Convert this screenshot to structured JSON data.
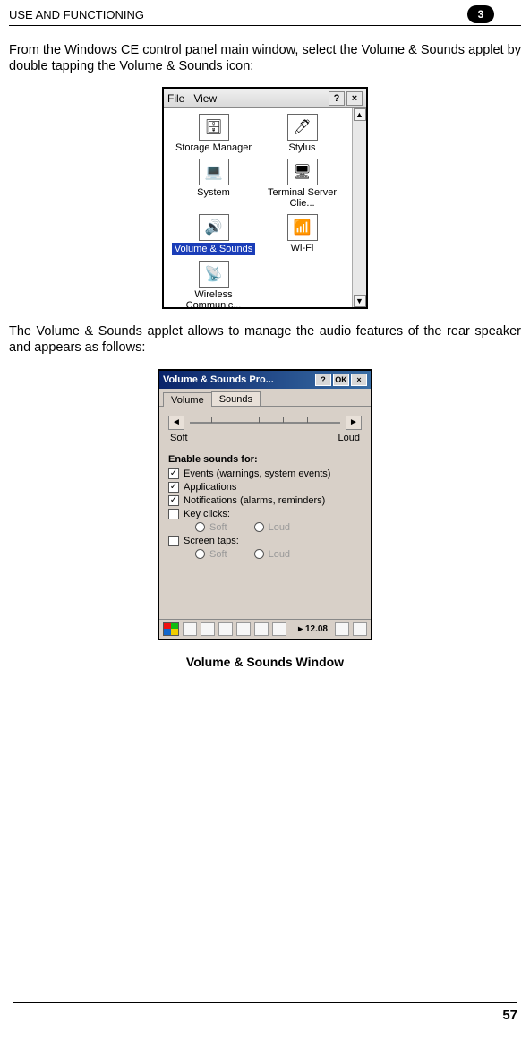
{
  "header": {
    "section_title": "USE AND FUNCTIONING",
    "chapter_number": "3"
  },
  "intro_para": "From the Windows CE control panel main window, select the Volume & Sounds applet by double tapping the Volume & Sounds icon:",
  "control_panel": {
    "menu_file": "File",
    "menu_view": "View",
    "btn_help": "?",
    "btn_close": "×",
    "scroll_up": "▲",
    "scroll_down": "▼",
    "applets": {
      "storage": "Storage Manager",
      "stylus": "Stylus",
      "system": "System",
      "terminal": "Terminal Server Clie...",
      "volume": "Volume & Sounds",
      "wifi": "Wi-Fi",
      "wireless": "Wireless Communic..."
    }
  },
  "applet_para": "The Volume & Sounds applet allows to manage the audio features of the rear speaker and appears as follows:",
  "volume_window": {
    "title": "Volume & Sounds Pro...",
    "btn_help": "?",
    "btn_ok": "OK",
    "btn_close": "×",
    "tab_volume": "Volume",
    "tab_sounds": "Sounds",
    "soft_label": "Soft",
    "loud_label": "Loud",
    "slider_left": "◄",
    "slider_right": "►",
    "enable_label": "Enable sounds for:",
    "chk_events": "Events (warnings, system events)",
    "chk_apps": "Applications",
    "chk_notif": "Notifications (alarms, reminders)",
    "chk_keys": "Key clicks:",
    "chk_taps": "Screen taps:",
    "radio_soft": "Soft",
    "radio_loud": "Loud",
    "taskbar_time": "▸ 12.08"
  },
  "caption": "Volume & Sounds Window",
  "page_number": "57"
}
